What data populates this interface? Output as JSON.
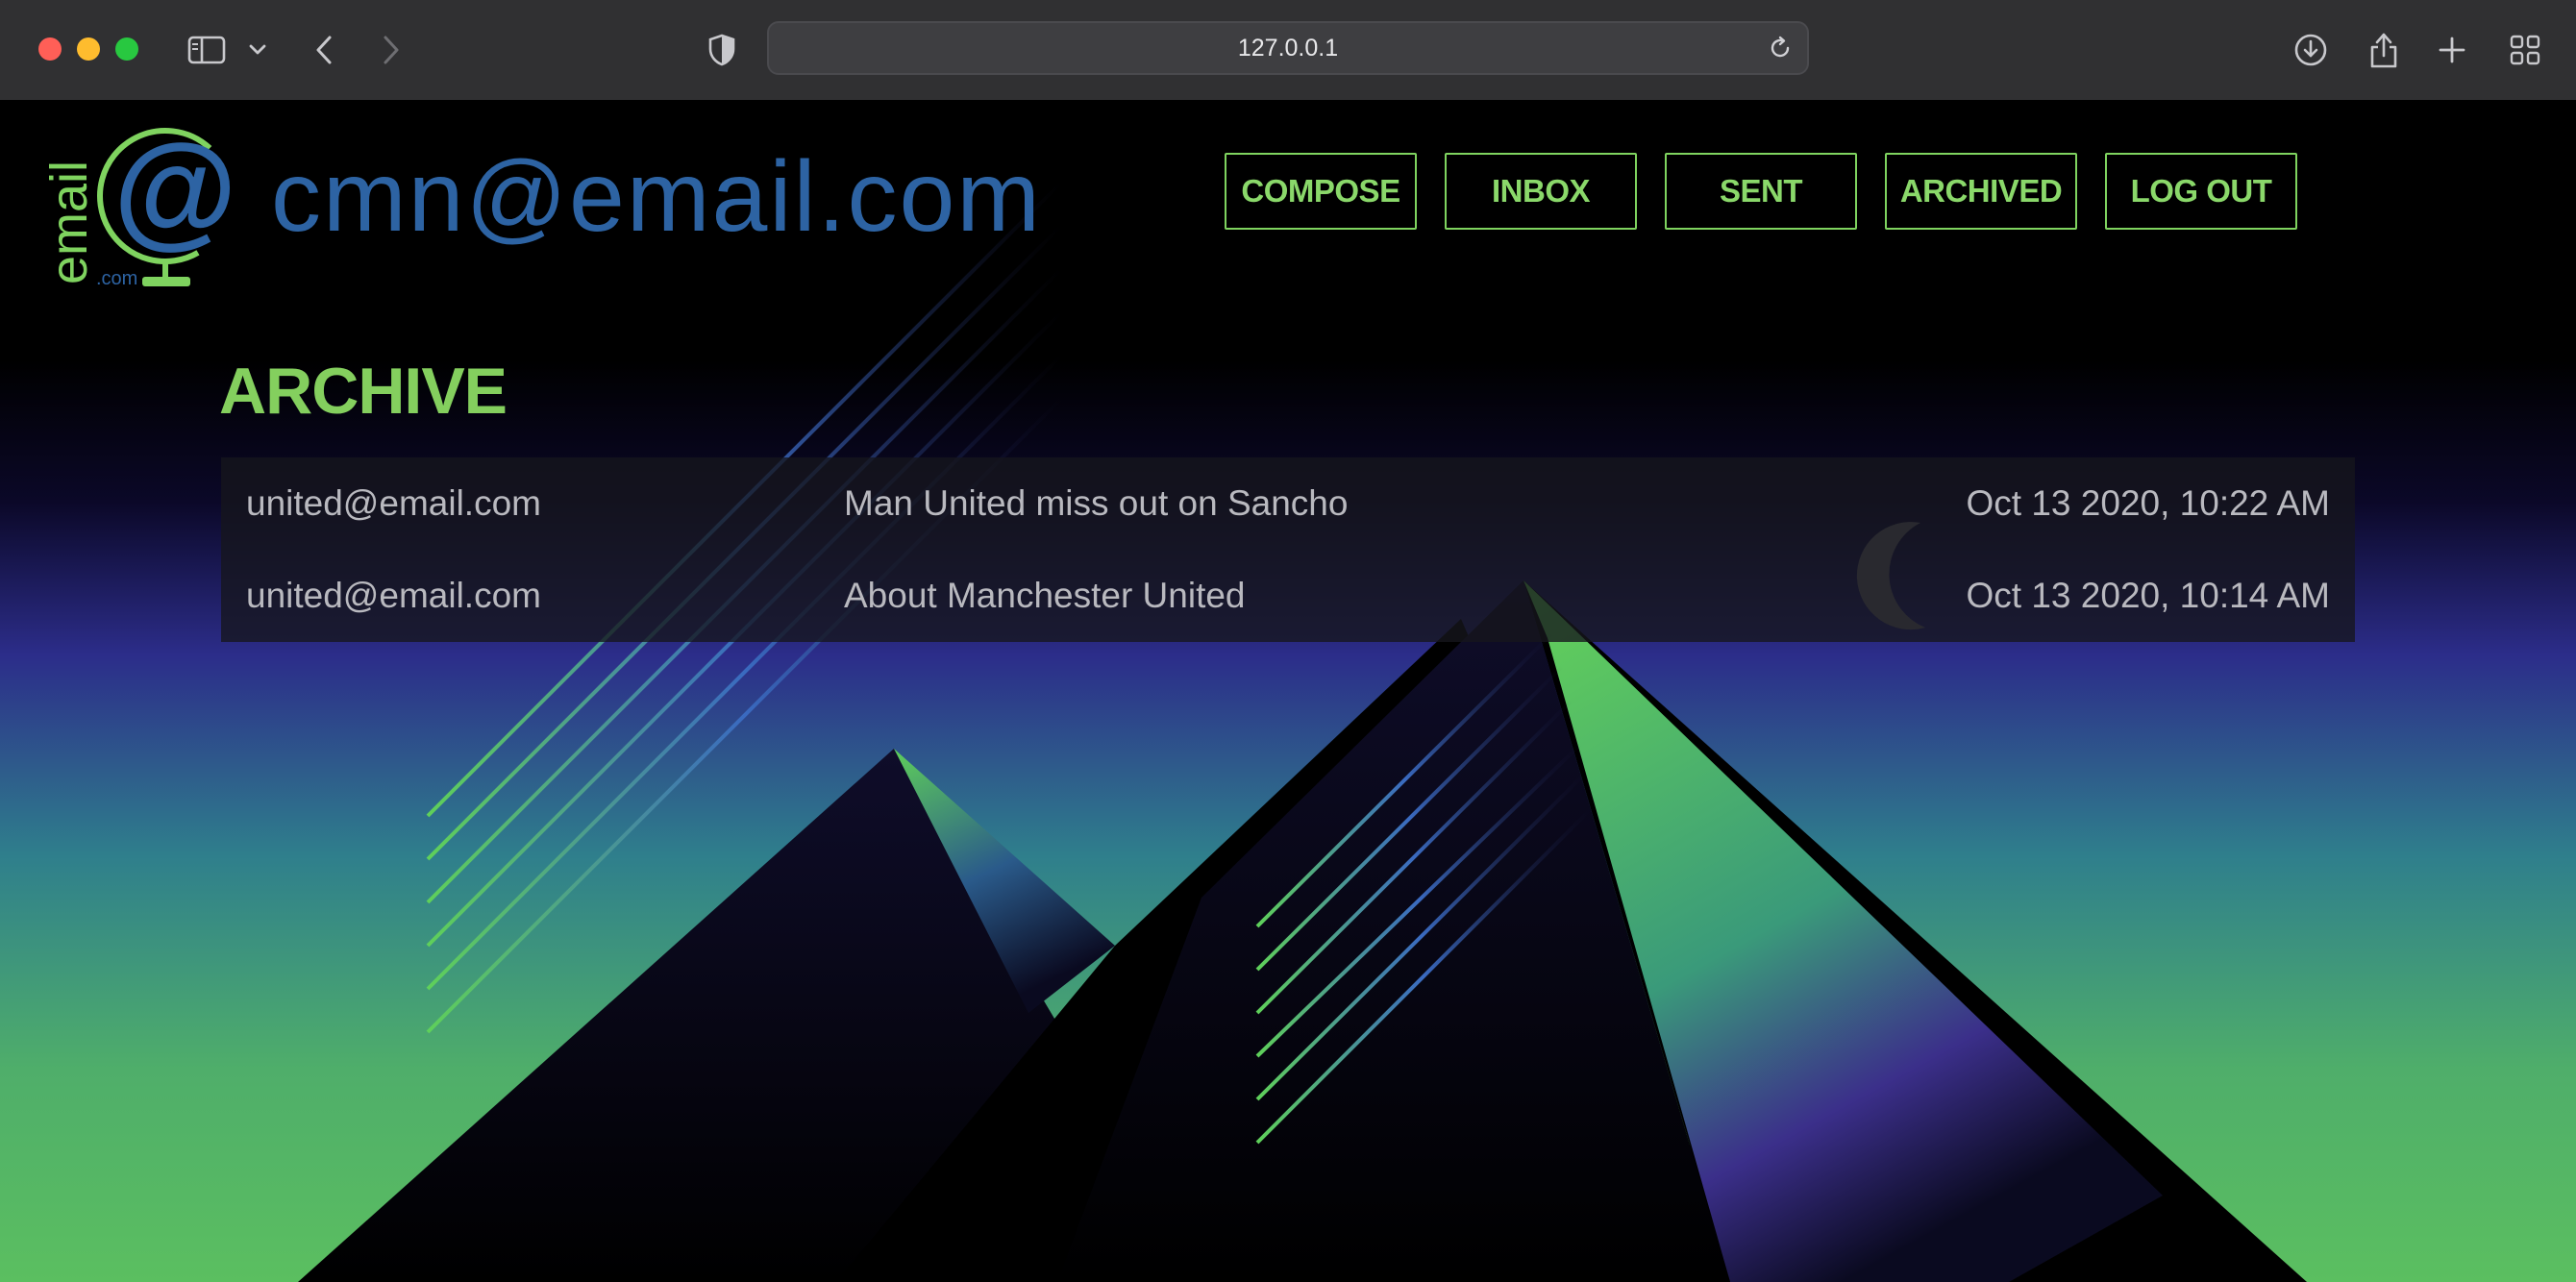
{
  "browser": {
    "url": "127.0.0.1"
  },
  "header": {
    "logo_text": "email",
    "logo_suffix": ".com",
    "user_email": "cmn@email.com"
  },
  "nav": {
    "compose": "COMPOSE",
    "inbox": "INBOX",
    "sent": "SENT",
    "archived": "ARCHIVED",
    "logout": "LOG OUT"
  },
  "mailbox": {
    "title": "ARCHIVE",
    "emails": [
      {
        "sender": "united@email.com",
        "subject": "Man United miss out on Sancho",
        "timestamp": "Oct 13 2020, 10:22 AM"
      },
      {
        "sender": "united@email.com",
        "subject": "About Manchester United",
        "timestamp": "Oct 13 2020, 10:14 AM"
      }
    ]
  },
  "colors": {
    "accent_green": "#84cf5e",
    "brand_blue": "#2d63a3",
    "background": "#000000"
  }
}
